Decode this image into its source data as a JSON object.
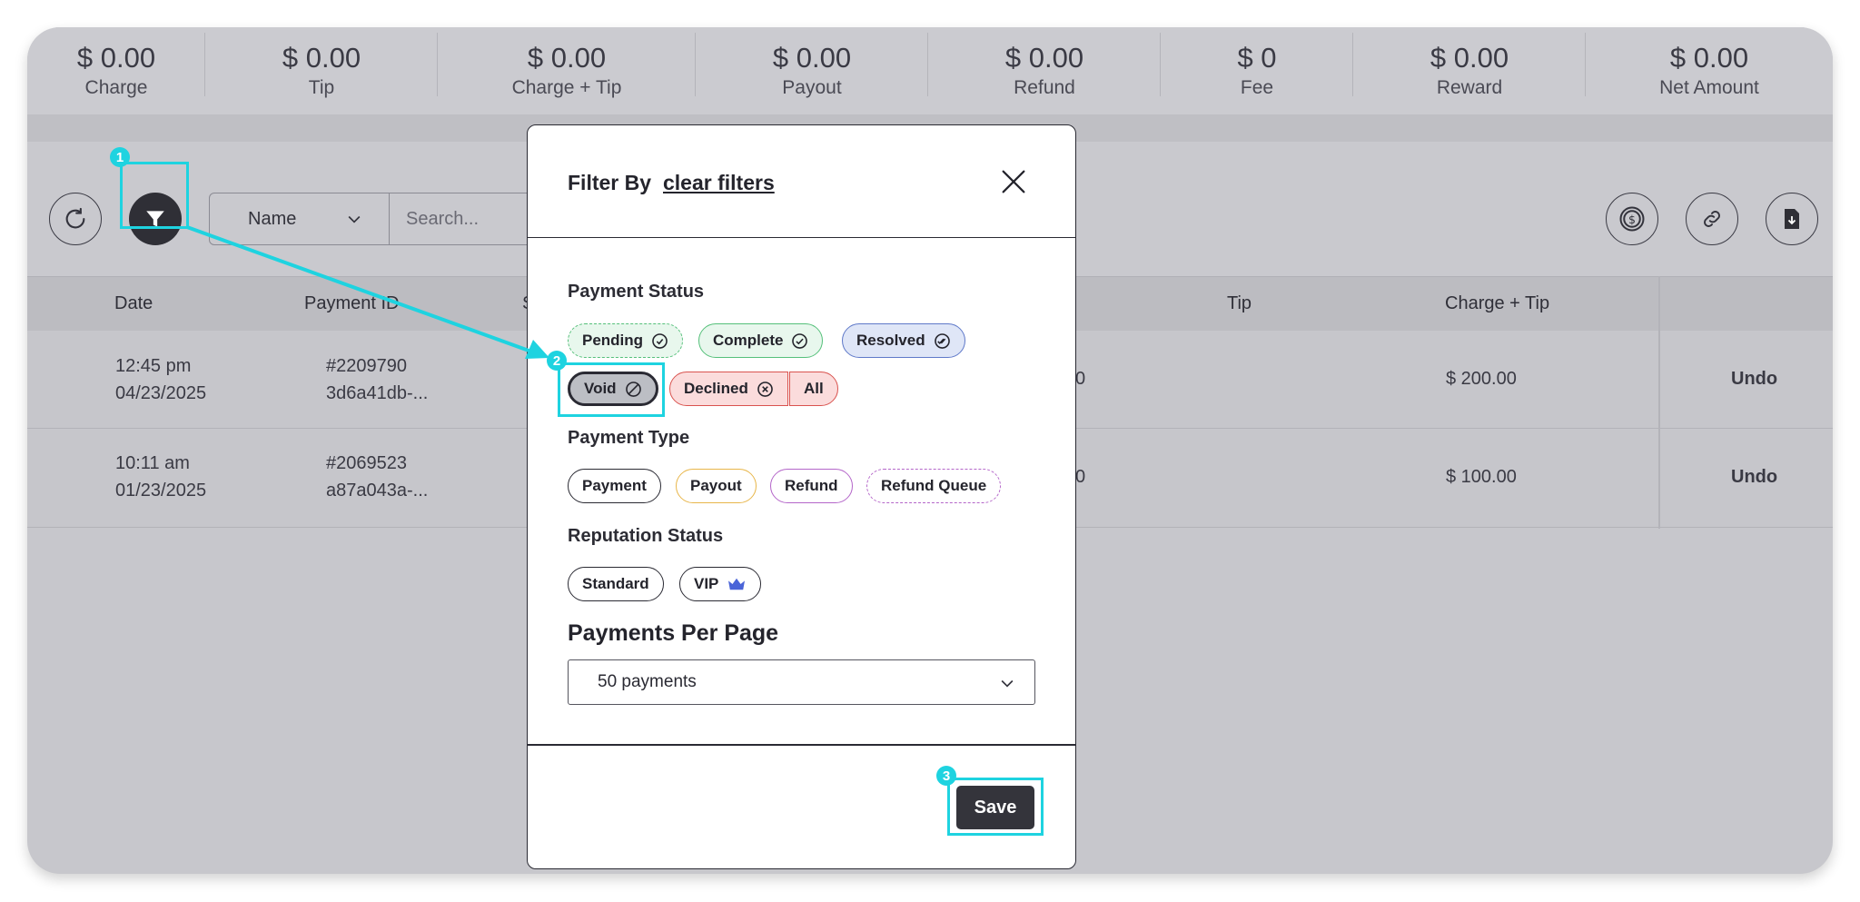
{
  "summary": [
    {
      "amount": "$ 0.00",
      "label": "Charge"
    },
    {
      "amount": "$ 0.00",
      "label": "Tip"
    },
    {
      "amount": "$ 0.00",
      "label": "Charge + Tip"
    },
    {
      "amount": "$ 0.00",
      "label": "Payout"
    },
    {
      "amount": "$ 0.00",
      "label": "Refund"
    },
    {
      "amount": "$ 0",
      "label": "Fee"
    },
    {
      "amount": "$ 0.00",
      "label": "Reward"
    },
    {
      "amount": "$ 0.00",
      "label": "Net Amount"
    }
  ],
  "toolbar": {
    "search_field_select": "Name",
    "search_placeholder": "Search..."
  },
  "table": {
    "headers": {
      "date": "Date",
      "payment_id": "Payment ID",
      "col3": "S",
      "tip": "Tip",
      "charge_tip": "Charge + Tip"
    },
    "rows": [
      {
        "time": "12:45 pm",
        "date": "04/23/2025",
        "id_num": "#2209790",
        "id_hash": "3d6a41db-...",
        "amount_partial": "0",
        "charge_tip": "$ 200.00",
        "action": "Undo"
      },
      {
        "time": "10:11 am",
        "date": "01/23/2025",
        "id_num": "#2069523",
        "id_hash": "a87a043a-...",
        "amount_partial": "0",
        "charge_tip": "$ 100.00",
        "action": "Undo"
      }
    ]
  },
  "modal": {
    "title": "Filter By",
    "clear_label": "clear filters",
    "payment_status_title": "Payment Status",
    "payment_status": {
      "pending": "Pending",
      "complete": "Complete",
      "resolved": "Resolved",
      "void": "Void",
      "declined": "Declined",
      "all": "All"
    },
    "payment_type_title": "Payment Type",
    "payment_type": {
      "payment": "Payment",
      "payout": "Payout",
      "refund": "Refund",
      "refund_queue": "Refund Queue"
    },
    "reputation_title": "Reputation Status",
    "reputation": {
      "standard": "Standard",
      "vip": "VIP"
    },
    "per_page_title": "Payments Per Page",
    "per_page_value": "50 payments",
    "save_label": "Save"
  },
  "annotations": [
    "1",
    "2",
    "3"
  ],
  "colors": {
    "accent": "#1ed3e0",
    "complete_green": "#55c07a",
    "resolved_blue": "#5f79c9",
    "declined_red": "#d9534f",
    "payout_orange": "#e8b64a",
    "refund_purple": "#b466c9",
    "vip_crown": "#4a64d8"
  }
}
